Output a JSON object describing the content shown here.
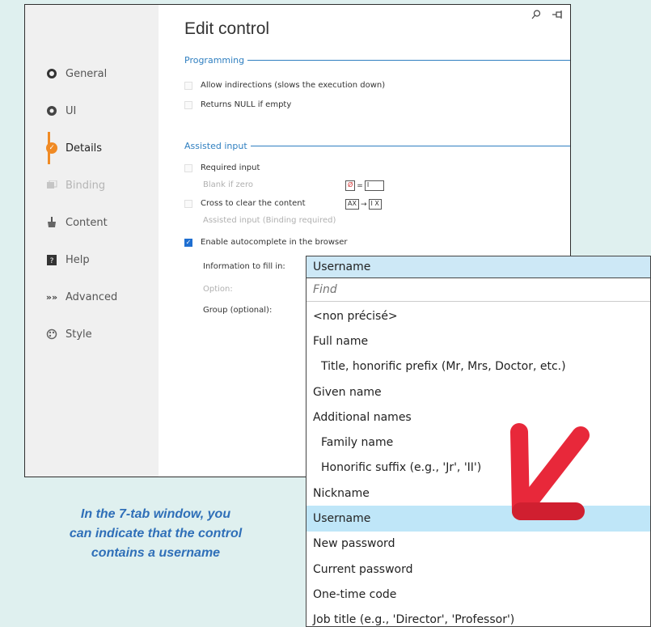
{
  "window": {
    "title": "Edit control",
    "top_icons": [
      "search-icon",
      "pin-icon"
    ]
  },
  "sidebar": {
    "items": [
      {
        "label": "General",
        "icon": "general-icon",
        "state": "normal"
      },
      {
        "label": "UI",
        "icon": "ui-icon",
        "state": "normal"
      },
      {
        "label": "Details",
        "icon": "details-icon",
        "state": "active"
      },
      {
        "label": "Binding",
        "icon": "binding-icon",
        "state": "disabled"
      },
      {
        "label": "Content",
        "icon": "content-icon",
        "state": "normal"
      },
      {
        "label": "Help",
        "icon": "help-icon",
        "state": "normal"
      },
      {
        "label": "Advanced",
        "icon": "advanced-icon",
        "state": "normal"
      },
      {
        "label": "Style",
        "icon": "style-icon",
        "state": "normal"
      }
    ]
  },
  "programming": {
    "heading": "Programming",
    "allow_indirections": "Allow indirections (slows the execution down)",
    "returns_null": "Returns NULL if empty"
  },
  "assisted": {
    "heading": "Assisted input",
    "required_input": "Required input",
    "blank_if_zero": "Blank if zero",
    "blank_glyph": "Ø",
    "blank_eq": "=",
    "blank_result": "I",
    "cross_to_clear": "Cross to clear the content",
    "cross_glyph": "AX",
    "cross_arrow": "→",
    "cross_result": "I X",
    "assisted_binding": "Assisted input (Binding required)",
    "enable_autocomplete": "Enable autocomplete in the browser",
    "info_label": "Information to fill in:",
    "option_label": "Option:",
    "group_label": "Group (optional):"
  },
  "dropdown": {
    "selected": "Username",
    "find_placeholder": "Find",
    "items": [
      {
        "label": "<non précisé>",
        "indent": false,
        "highlighted": false
      },
      {
        "label": "Full name",
        "indent": false,
        "highlighted": false
      },
      {
        "label": "Title, honorific prefix (Mr, Mrs, Doctor, etc.)",
        "indent": true,
        "highlighted": false
      },
      {
        "label": "Given name",
        "indent": false,
        "highlighted": false
      },
      {
        "label": "Additional names",
        "indent": false,
        "highlighted": false
      },
      {
        "label": "Family name",
        "indent": true,
        "highlighted": false
      },
      {
        "label": "Honorific suffix (e.g., 'Jr', 'II')",
        "indent": true,
        "highlighted": false
      },
      {
        "label": "Nickname",
        "indent": false,
        "highlighted": false
      },
      {
        "label": "Username",
        "indent": false,
        "highlighted": true
      },
      {
        "label": "New password",
        "indent": false,
        "highlighted": false
      },
      {
        "label": "Current password",
        "indent": false,
        "highlighted": false
      },
      {
        "label": "One-time code",
        "indent": false,
        "highlighted": false
      },
      {
        "label": "Job title (e.g., 'Director', 'Professor')",
        "indent": false,
        "highlighted": false
      }
    ]
  },
  "caption": {
    "line1": "In the 7-tab window, you",
    "line2": "can indicate that the control",
    "line3": "contains a username"
  },
  "colors": {
    "accent": "#2f7fc0",
    "active_tab": "#f08a24",
    "highlight": "#bfe6f8",
    "arrow": "#e8283a"
  }
}
